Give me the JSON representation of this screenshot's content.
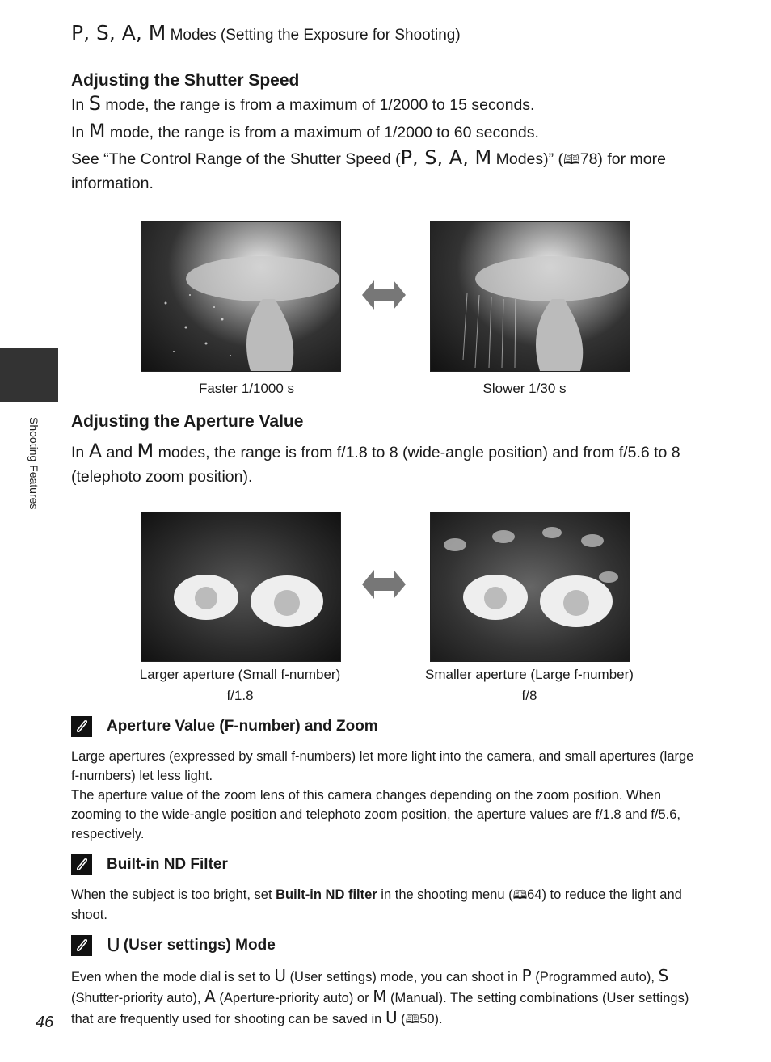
{
  "header": {
    "mode_letters": "P, S, A, M",
    "title": "Modes (Setting the Exposure for Shooting)"
  },
  "side_tab": {
    "label": "Shooting Features"
  },
  "shutter": {
    "heading": "Adjusting the Shutter Speed",
    "line1": {
      "pre": "In",
      "mode": "S",
      "post": "mode, the range is from a maximum of 1/2000 to 15 seconds."
    },
    "line2": {
      "pre": "In",
      "mode": "M",
      "post": "mode, the range is from a maximum of 1/2000 to 60 seconds."
    },
    "line3": {
      "pre": "See “The Control Range of the Shutter Speed (",
      "modes": "P, S, A, M",
      "mid": "Modes)” (",
      "ref_icon": "book-icon",
      "ref": "78",
      "post": ") for more information."
    },
    "images": [
      {
        "alt": "fountain-photo-fast",
        "caption": "Faster 1/1000 s"
      },
      {
        "alt": "fountain-photo-slow",
        "caption": "Slower 1/30 s"
      }
    ],
    "arrow_icon": "double-arrow-icon"
  },
  "aperture": {
    "heading": "Adjusting the Aperture Value",
    "text": {
      "pre": "In",
      "mode1": "A",
      "and": "and",
      "mode2": "M",
      "post": "modes, the range is from f/1.8 to 8 (wide-angle position) and from f/5.6 to 8 (telephoto zoom position)."
    },
    "images": [
      {
        "alt": "flower-photo-large-aperture",
        "caption": "Larger aperture (Small f-number)",
        "value": "f/1.8"
      },
      {
        "alt": "flower-photo-small-aperture",
        "caption": "Smaller aperture (Large f-number)",
        "value": "f/8"
      }
    ],
    "arrow_icon": "double-arrow-icon"
  },
  "notes": [
    {
      "icon": "note-icon",
      "title": "Aperture Value (F-number) and Zoom",
      "paragraphs": [
        "Large apertures (expressed by small f-numbers) let more light into the camera, and small apertures (large f-numbers) let less light.",
        "The aperture value of the zoom lens of this camera changes depending on the zoom position. When zooming to the wide-angle position and telephoto zoom position, the aperture values are f/1.8 and f/5.6, respectively."
      ]
    },
    {
      "icon": "note-icon",
      "title": "Built-in ND Filter",
      "text_pre": "When the subject is too bright, set ",
      "text_bold": "Built-in ND filter",
      "text_mid": " in the shooting menu (",
      "ref": "64",
      "text_post": ") to reduce the light and shoot."
    },
    {
      "icon": "note-icon",
      "title_mode": "U",
      "title": "(User settings) Mode",
      "parts": {
        "p1": "Even when the mode dial is set to",
        "m_u": "U",
        "p2": "(User settings) mode, you can shoot in",
        "m_p": "P",
        "p3": "(Programmed auto),",
        "m_s": "S",
        "p4": "(Shutter-priority auto),",
        "m_a": "A",
        "p5": "(Aperture-priority auto) or",
        "m_m": "M",
        "p6": "(Manual). The setting combinations (User settings) that are frequently used for shooting can be saved in",
        "m_u2": "U",
        "p7": "(",
        "ref": "50",
        "p8": ")."
      }
    }
  ],
  "page_number": "46"
}
